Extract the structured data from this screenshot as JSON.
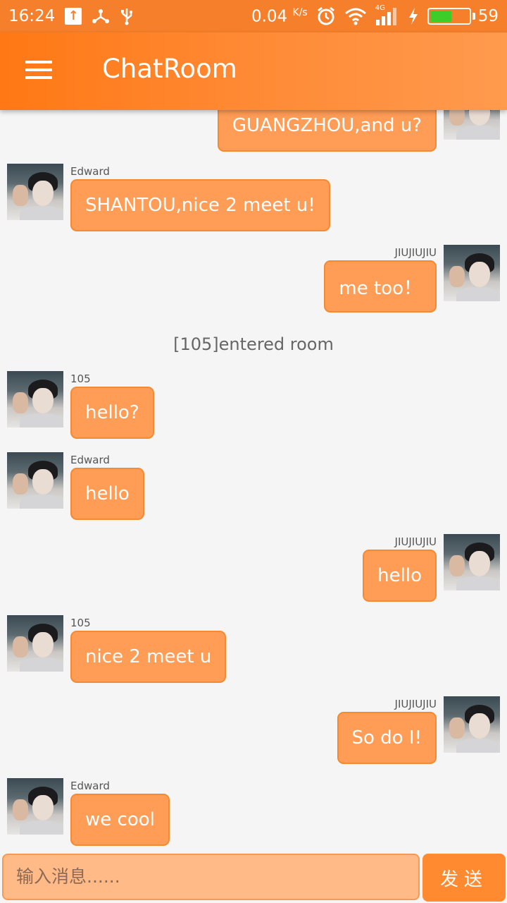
{
  "status_bar": {
    "time": "16:24",
    "net_speed": "0.04",
    "net_unit": "K/s",
    "network_type": "4G",
    "battery": "59",
    "battery_level_percent": 59,
    "icons": [
      "upload-icon",
      "share-icon",
      "usb-icon",
      "alarm-icon",
      "wifi-icon",
      "signal-icon",
      "charging-icon",
      "battery-icon"
    ]
  },
  "app_bar": {
    "title": "ChatRoom",
    "menu_icon": "hamburger-menu-icon"
  },
  "messages": [
    {
      "side": "right",
      "name": "",
      "text": "GUANGZHOU,and u?"
    },
    {
      "side": "left",
      "name": "Edward",
      "text": "SHANTOU,nice 2 meet u!"
    },
    {
      "side": "right",
      "name": "JIUJIUJIU",
      "text": "me too！"
    },
    {
      "type": "system",
      "text": "[105]entered room"
    },
    {
      "side": "left",
      "name": "105",
      "text": "hello?"
    },
    {
      "side": "left",
      "name": "Edward",
      "text": "hello"
    },
    {
      "side": "right",
      "name": "JIUJIUJIU",
      "text": "hello"
    },
    {
      "side": "left",
      "name": "105",
      "text": "nice 2 meet u"
    },
    {
      "side": "right",
      "name": "JIUJIUJIU",
      "text": "So do I!"
    },
    {
      "side": "left",
      "name": "Edward",
      "text": "we cool"
    }
  ],
  "input": {
    "placeholder": "输入消息......",
    "send_label": "发送"
  },
  "colors": {
    "accent": "#ff8a30",
    "bubble": "#ff9c55",
    "status_bar": "#f57f2a"
  }
}
